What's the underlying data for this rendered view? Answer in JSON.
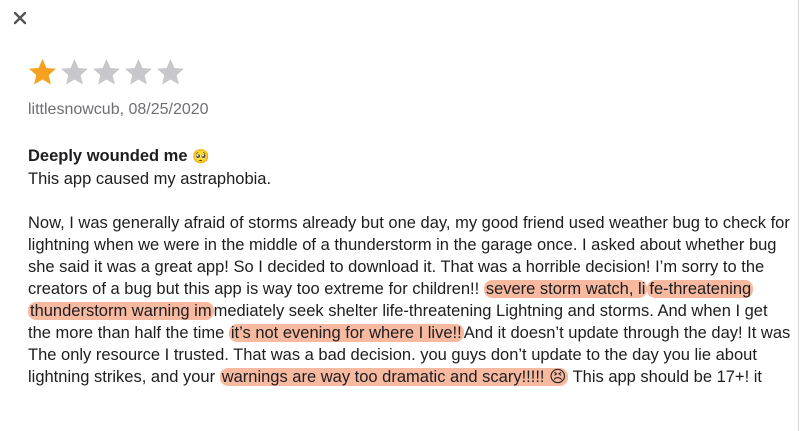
{
  "window": {
    "close_icon": "close-icon"
  },
  "rating": {
    "value": 1,
    "max": 5,
    "filled_color": "#f6a21e",
    "empty_color": "#c7c7cc"
  },
  "review": {
    "author_date": "littlesnowcub, 08/25/2020",
    "title": "Deeply wounded me",
    "title_emoji": "🥺",
    "intro": "This app caused my astraphobia.",
    "body": [
      {
        "text": "Now, I was generally afraid of storms already but one day, my good friend used weather bug to check for lightning when we were in the middle of a thunderstorm in the garage once. I asked about whether bug she said it was a great app! So I decided to download it. That was a horrible decision! I’m sorry to the creators of a bug but this app is way too extreme for children!! ",
        "hl": false
      },
      {
        "text": "severe storm watch, li",
        "hl": true
      },
      {
        "text": "fe-threatening thunderstorm warning im",
        "hl": true
      },
      {
        "text": "mediately seek shelter life-threatening Lightning and storms. And when I get the more than half the time ",
        "hl": false
      },
      {
        "text": "it’s not evening for where I live!!",
        "hl": true
      },
      {
        "text": "And it doesn’t update through the day! It was The only resource I trusted. That was a bad decision. you guys don’t update to the day you lie about lightning strikes, and your ",
        "hl": false
      },
      {
        "text": "warnings are way too dramatic and scary!!!!! 😣",
        "hl": true
      },
      {
        "text": "  This app should be 17+! it",
        "hl": false
      }
    ]
  },
  "colors": {
    "highlight": "#f0a584",
    "text": "#1d1d1f",
    "meta": "#6e6e73"
  }
}
